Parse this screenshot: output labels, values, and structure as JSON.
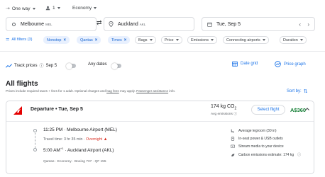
{
  "top": {
    "trip_type": "One way",
    "passengers": "1",
    "cabin": "Economy"
  },
  "search": {
    "origin": "Melbourne",
    "origin_code": "MEL",
    "destination": "Auckland",
    "destination_code": "AKL",
    "date": "Tue, Sep 5"
  },
  "filters": {
    "all": "All filters (3)",
    "chips": [
      {
        "label": "Nonstop",
        "active": true
      },
      {
        "label": "Qantas",
        "active": true
      },
      {
        "label": "Times",
        "active": true
      },
      {
        "label": "Bags",
        "active": false
      },
      {
        "label": "Price",
        "active": false
      },
      {
        "label": "Emissions",
        "active": false
      },
      {
        "label": "Connecting airports",
        "active": false
      },
      {
        "label": "Duration",
        "active": false
      }
    ]
  },
  "tracking": {
    "track_label": "Track prices",
    "track_date": "Sep 5",
    "any_dates": "Any dates",
    "date_grid": "Date grid",
    "price_graph": "Price graph"
  },
  "results": {
    "heading": "All flights",
    "note_prefix": "Prices include required taxes + fees for 1 adult. Optional charges and ",
    "note_link1": "bag fees",
    "note_mid": " may apply. ",
    "note_link2": "Passenger assistance",
    "note_suffix": " info.",
    "sort_label": "Sort by:"
  },
  "flight": {
    "title": "Departure • Tue, Sep 5",
    "emissions_value": "174 kg CO",
    "emissions_sub": "2",
    "emissions_label": "Avg emissions",
    "select_label": "Select flight",
    "price": "A$360",
    "depart_time": "11:25 PM",
    "depart_airport": "Melbourne Airport (MEL)",
    "travel_time": "Travel time: 3 hr 35 min",
    "overnight": "Overnight",
    "arrive_time": "5:00 AM",
    "arrive_plus": "+1",
    "arrive_airport": "Auckland Airport (AKL)",
    "details": "Qantas · Economy · Boeing 737 · QF 155",
    "amenities": [
      {
        "icon": "legroom-icon",
        "text": "Average legroom (30 in)"
      },
      {
        "icon": "power-outlet-icon",
        "text": "In-seat power & USB outlets"
      },
      {
        "icon": "stream-media-icon",
        "text": "Stream media to your device"
      },
      {
        "icon": "co2-icon",
        "text": "Carbon emissions estimate: 174 kg"
      }
    ]
  },
  "colors": {
    "accent": "#1a73e8",
    "price": "#188038",
    "warning": "#d93025",
    "qantas": "#e40000"
  }
}
